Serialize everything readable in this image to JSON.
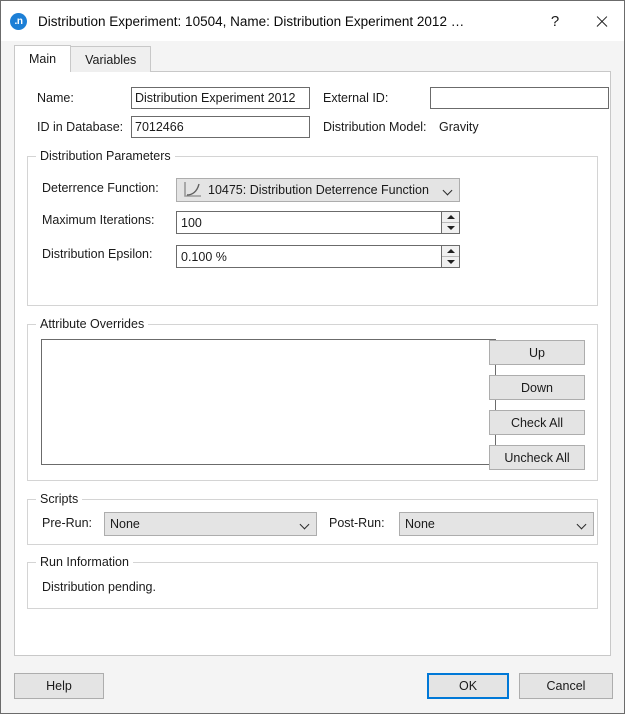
{
  "window": {
    "title": "Distribution Experiment: 10504, Name: Distribution Experiment 2012  …",
    "app_icon": ".n",
    "help_button": "?",
    "close_icon": "close-icon",
    "border_color": "#6b6b6b"
  },
  "tabs": [
    {
      "label": "Main",
      "active": true
    },
    {
      "label": "Variables",
      "active": false
    }
  ],
  "main": {
    "fields": {
      "name_label": "Name:",
      "name_value": "Distribution Experiment 2012",
      "external_id_label": "External ID:",
      "external_id_value": "",
      "id_in_database_label": "ID in Database:",
      "id_in_database_value": "7012466",
      "distribution_model_label": "Distribution Model:",
      "distribution_model_value": "Gravity"
    },
    "distribution_parameters": {
      "legend": "Distribution Parameters",
      "deterrence_function_label": "Deterrence Function:",
      "deterrence_function_value": "10475: Distribution Deterrence Function",
      "deterrence_function_icon": "curve-chart-icon",
      "maximum_iterations_label": "Maximum Iterations:",
      "maximum_iterations_value": "100",
      "distribution_epsilon_label": "Distribution Epsilon:",
      "distribution_epsilon_value": "0.100 %"
    },
    "attribute_overrides": {
      "legend": "Attribute Overrides",
      "items": [],
      "buttons": [
        "Up",
        "Down",
        "Check All",
        "Uncheck All"
      ]
    },
    "scripts": {
      "legend": "Scripts",
      "pre_run_label": "Pre-Run:",
      "pre_run_value": "None",
      "post_run_label": "Post-Run:",
      "post_run_value": "None"
    },
    "run_information": {
      "legend": "Run Information",
      "status_text": "Distribution pending."
    }
  },
  "footer": {
    "help_label": "Help",
    "ok_label": "OK",
    "cancel_label": "Cancel",
    "focus_color": "#0078d7"
  }
}
